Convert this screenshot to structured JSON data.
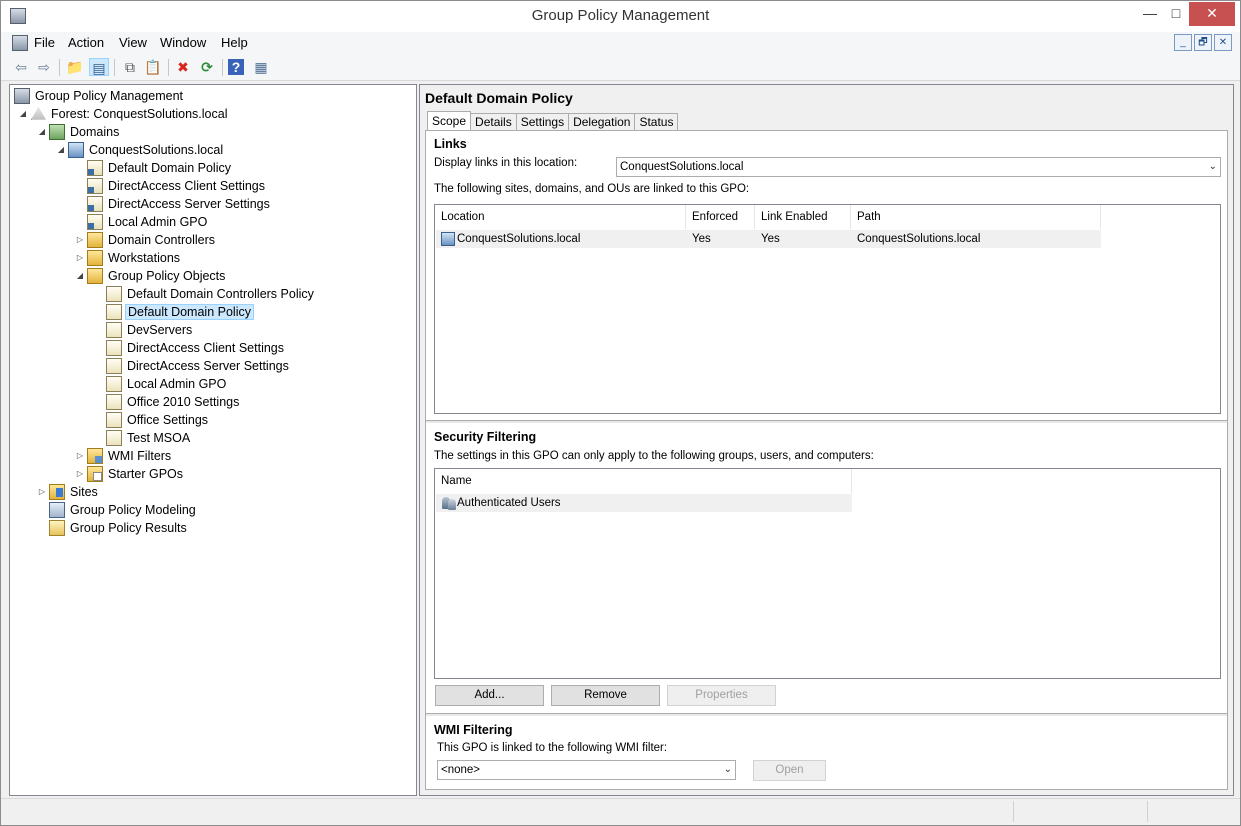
{
  "window": {
    "title": "Group Policy Management"
  },
  "window_buttons": {
    "minimize": "—",
    "maximize": "□",
    "close": "✕"
  },
  "mdi_buttons": {
    "minimize": "_",
    "restore": "🗗",
    "close": "✕"
  },
  "menu": [
    {
      "label": "File"
    },
    {
      "label": "Action"
    },
    {
      "label": "View"
    },
    {
      "label": "Window"
    },
    {
      "label": "Help"
    }
  ],
  "toolbar": {
    "back": "⇦",
    "forward": "⇨",
    "up": "📁",
    "show_hide": "▤",
    "copy": "⧉",
    "paste": "📋",
    "delete": "✖",
    "refresh": "⟳",
    "help": "?",
    "properties": "▦"
  },
  "tree": {
    "root": "Group Policy Management",
    "forest": "Forest: ConquestSolutions.local",
    "domains": "Domains",
    "domain": "ConquestSolutions.local",
    "linked": [
      "Default Domain Policy",
      "DirectAccess Client Settings",
      "DirectAccess Server Settings",
      "Local Admin GPO"
    ],
    "ous": [
      "Domain Controllers",
      "Workstations"
    ],
    "gpo_container": "Group Policy Objects",
    "gpos": [
      "Default Domain Controllers Policy",
      "Default Domain Policy",
      "DevServers",
      "DirectAccess Client Settings",
      "DirectAccess Server Settings",
      "Local Admin GPO",
      "Office 2010 Settings",
      "Office Settings",
      "Test MSOA"
    ],
    "wmi_filters": "WMI Filters",
    "starter_gpos": "Starter GPOs",
    "sites": "Sites",
    "modeling": "Group Policy Modeling",
    "results": "Group Policy Results"
  },
  "details": {
    "title": "Default Domain Policy",
    "tabs": [
      "Scope",
      "Details",
      "Settings",
      "Delegation",
      "Status"
    ],
    "links": {
      "heading": "Links",
      "display_label": "Display links in this location:",
      "display_value": "ConquestSolutions.local",
      "description": "The following sites, domains, and OUs are linked to this GPO:",
      "columns": [
        "Location",
        "Enforced",
        "Link Enabled",
        "Path"
      ],
      "rows": [
        {
          "location": "ConquestSolutions.local",
          "enforced": "Yes",
          "link_enabled": "Yes",
          "path": "ConquestSolutions.local"
        }
      ]
    },
    "security": {
      "heading": "Security Filtering",
      "description": "The settings in this GPO can only apply to the following groups, users, and computers:",
      "column": "Name",
      "rows": [
        "Authenticated Users"
      ],
      "add_label": "Add...",
      "remove_label": "Remove",
      "properties_label": "Properties"
    },
    "wmi": {
      "heading": "WMI Filtering",
      "description": "This GPO is linked to the following WMI filter:",
      "value": "<none>",
      "open_label": "Open"
    }
  }
}
